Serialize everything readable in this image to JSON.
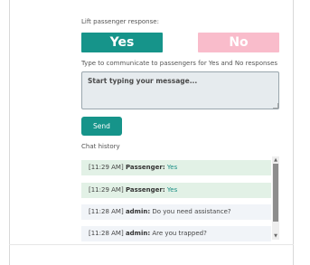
{
  "response": {
    "label": "Lift passenger response:",
    "yes_label": "Yes",
    "no_label": "No"
  },
  "message": {
    "label": "Type to communicate to passengers for Yes and No responses",
    "placeholder": "Start typing your message...",
    "send_label": "Send"
  },
  "chat": {
    "label": "Chat history",
    "entries": [
      {
        "time": "[11:29 AM]",
        "sender": "Passenger:",
        "text": "Yes"
      },
      {
        "time": "[11:29 AM]",
        "sender": "Passenger:",
        "text": "Yes"
      },
      {
        "time": "[11:28 AM]",
        "sender": "admin:",
        "text": "Do you need assistance?"
      },
      {
        "time": "[11:28 AM]",
        "sender": "admin:",
        "text": "Are you trapped?"
      }
    ]
  },
  "icons": {
    "scroll_up": "▲",
    "scroll_down": "▼"
  },
  "colors": {
    "accent": "#16948a",
    "no_button": "#f9bccb",
    "passenger_row": "#e2f1e6",
    "admin_row": "#f1f4f8"
  }
}
